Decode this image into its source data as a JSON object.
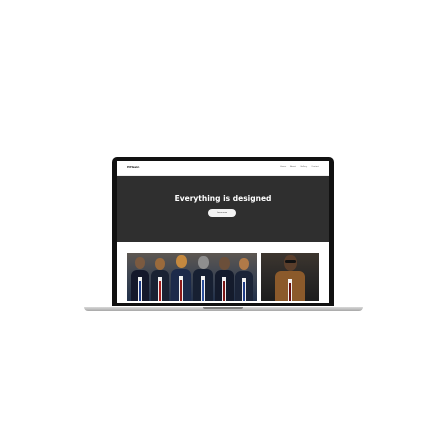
{
  "site": {
    "logo": "HPGain",
    "nav_links": [
      "Home",
      "About",
      "Gallery",
      "Contact"
    ],
    "hero_title": "Everything is designed",
    "hero_button": "Learn more"
  },
  "colors": {
    "hero_background": "#2f2f2f",
    "hero_title": "#ffffff",
    "laptop_bezel": "#111111"
  },
  "icons": [
    "laptop-icon"
  ]
}
